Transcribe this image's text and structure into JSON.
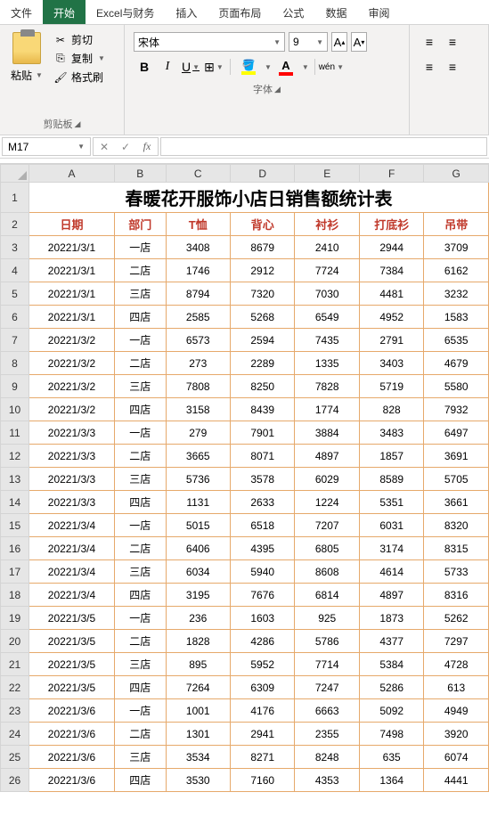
{
  "ribbon": {
    "tabs": [
      "文件",
      "开始",
      "Excel与财务",
      "插入",
      "页面布局",
      "公式",
      "数据",
      "审阅"
    ],
    "active_tab": 1,
    "clipboard": {
      "paste": "粘贴",
      "cut": "剪切",
      "copy": "复制",
      "format_painter": "格式刷",
      "group_label": "剪贴板"
    },
    "font": {
      "name": "宋体",
      "size": "9",
      "bold": "B",
      "italic": "I",
      "underline": "U",
      "wen": "wén",
      "group_label": "字体"
    }
  },
  "name_box": "M17",
  "formula_value": "",
  "columns": [
    "A",
    "B",
    "C",
    "D",
    "E",
    "F",
    "G"
  ],
  "sheet_title": "春暖花开服饰小店日销售额统计表",
  "headers": [
    "日期",
    "部门",
    "T恤",
    "背心",
    "衬衫",
    "打底衫",
    "吊带"
  ],
  "rows": [
    [
      "20221/3/1",
      "一店",
      "3408",
      "8679",
      "2410",
      "2944",
      "3709"
    ],
    [
      "20221/3/1",
      "二店",
      "1746",
      "2912",
      "7724",
      "7384",
      "6162"
    ],
    [
      "20221/3/1",
      "三店",
      "8794",
      "7320",
      "7030",
      "4481",
      "3232"
    ],
    [
      "20221/3/1",
      "四店",
      "2585",
      "5268",
      "6549",
      "4952",
      "1583"
    ],
    [
      "20221/3/2",
      "一店",
      "6573",
      "2594",
      "7435",
      "2791",
      "6535"
    ],
    [
      "20221/3/2",
      "二店",
      "273",
      "2289",
      "1335",
      "3403",
      "4679"
    ],
    [
      "20221/3/2",
      "三店",
      "7808",
      "8250",
      "7828",
      "5719",
      "5580"
    ],
    [
      "20221/3/2",
      "四店",
      "3158",
      "8439",
      "1774",
      "828",
      "7932"
    ],
    [
      "20221/3/3",
      "一店",
      "279",
      "7901",
      "3884",
      "3483",
      "6497"
    ],
    [
      "20221/3/3",
      "二店",
      "3665",
      "8071",
      "4897",
      "1857",
      "3691"
    ],
    [
      "20221/3/3",
      "三店",
      "5736",
      "3578",
      "6029",
      "8589",
      "5705"
    ],
    [
      "20221/3/3",
      "四店",
      "1131",
      "2633",
      "1224",
      "5351",
      "3661"
    ],
    [
      "20221/3/4",
      "一店",
      "5015",
      "6518",
      "7207",
      "6031",
      "8320"
    ],
    [
      "20221/3/4",
      "二店",
      "6406",
      "4395",
      "6805",
      "3174",
      "8315"
    ],
    [
      "20221/3/4",
      "三店",
      "6034",
      "5940",
      "8608",
      "4614",
      "5733"
    ],
    [
      "20221/3/4",
      "四店",
      "3195",
      "7676",
      "6814",
      "4897",
      "8316"
    ],
    [
      "20221/3/5",
      "一店",
      "236",
      "1603",
      "925",
      "1873",
      "5262"
    ],
    [
      "20221/3/5",
      "二店",
      "1828",
      "4286",
      "5786",
      "4377",
      "7297"
    ],
    [
      "20221/3/5",
      "三店",
      "895",
      "5952",
      "7714",
      "5384",
      "4728"
    ],
    [
      "20221/3/5",
      "四店",
      "7264",
      "6309",
      "7247",
      "5286",
      "613"
    ],
    [
      "20221/3/6",
      "一店",
      "1001",
      "4176",
      "6663",
      "5092",
      "4949"
    ],
    [
      "20221/3/6",
      "二店",
      "1301",
      "2941",
      "2355",
      "7498",
      "3920"
    ],
    [
      "20221/3/6",
      "三店",
      "3534",
      "8271",
      "8248",
      "635",
      "6074"
    ],
    [
      "20221/3/6",
      "四店",
      "3530",
      "7160",
      "4353",
      "1364",
      "4441"
    ]
  ],
  "col_widths": [
    "30px",
    "90px",
    "54px",
    "68px",
    "68px",
    "68px",
    "68px",
    "68px"
  ]
}
